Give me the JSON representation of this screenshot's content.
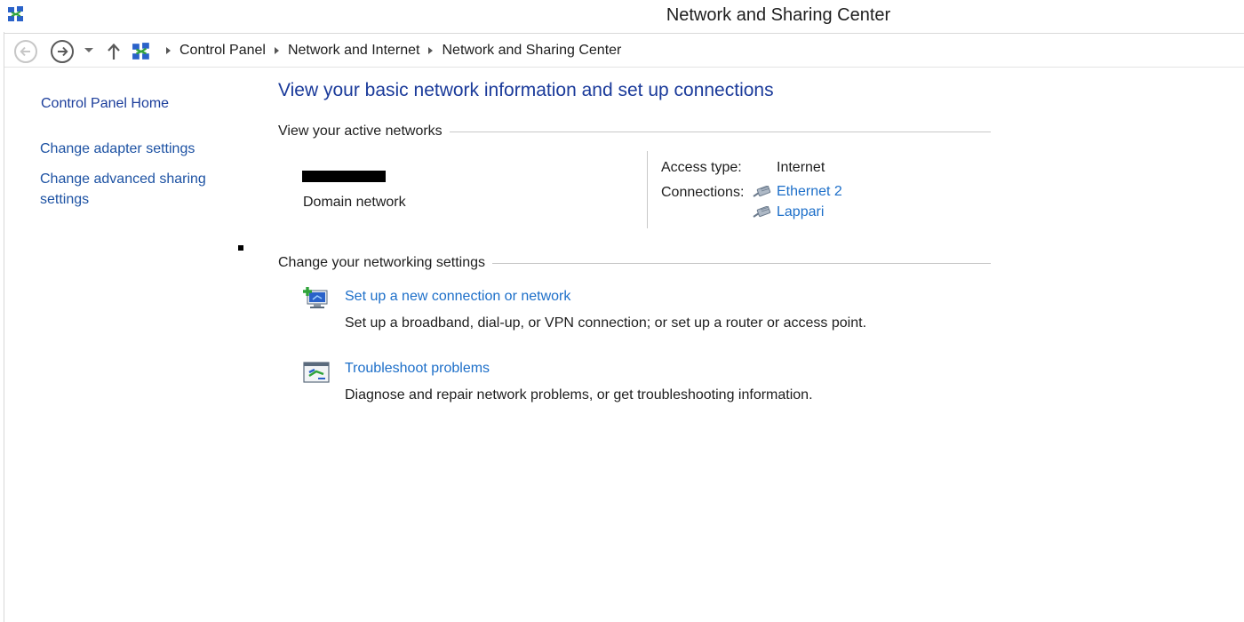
{
  "window": {
    "title": "Network and Sharing Center",
    "icon": "network-center-icon"
  },
  "address_bar": {
    "back_icon": "back-arrow-icon",
    "forward_icon": "forward-arrow-icon",
    "up_icon": "up-arrow-icon",
    "breadcrumbs": [
      "Control Panel",
      "Network and Internet",
      "Network and Sharing Center"
    ]
  },
  "sidebar": {
    "home": "Control Panel Home",
    "links": [
      "Change adapter settings",
      "Change advanced sharing settings"
    ]
  },
  "main": {
    "heading": "View your basic network information and set up connections",
    "active_networks_title": "View your active networks",
    "network": {
      "type": "Domain network",
      "access_type_label": "Access type:",
      "access_type_value": "Internet",
      "connections_label": "Connections:",
      "connections": [
        "Ethernet 2",
        "Lappari"
      ]
    },
    "settings_title": "Change your networking settings",
    "tasks": [
      {
        "link": "Set up a new connection or network",
        "description": "Set up a broadband, dial-up, or VPN connection; or set up a router or access point.",
        "icon": "new-connection-icon"
      },
      {
        "link": "Troubleshoot problems",
        "description": "Diagnose and repair network problems, or get troubleshooting information.",
        "icon": "troubleshoot-icon"
      }
    ]
  },
  "colors": {
    "heading": "#1a3a9a",
    "link": "#1d6fc9",
    "sidebar_link": "#1d52a3"
  }
}
